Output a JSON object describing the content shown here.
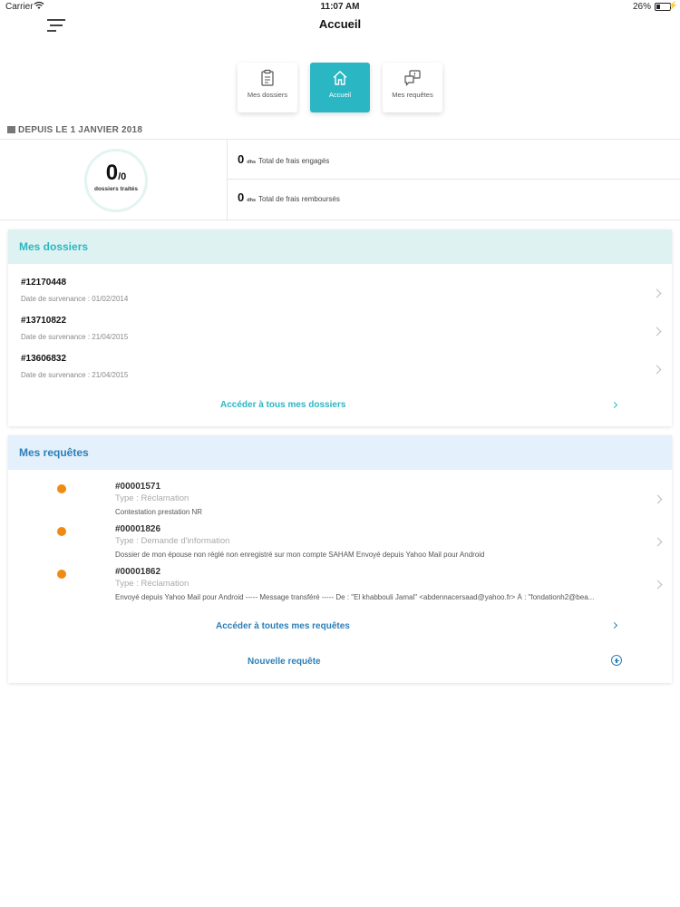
{
  "status_bar": {
    "carrier": "Carrier",
    "time": "11:07 AM",
    "battery": "26%"
  },
  "header": {
    "title": "Accueil"
  },
  "tabs": [
    {
      "label": "Mes dossiers",
      "icon": "clipboard-icon"
    },
    {
      "label": "Accueil",
      "icon": "home-icon"
    },
    {
      "label": "Mes requêtes",
      "icon": "chat-icon"
    }
  ],
  "since_label": "DEPUIS LE 1 JANVIER 2018",
  "summary": {
    "count": "0",
    "total": "/0",
    "count_label": "dossiers traités",
    "stats": [
      {
        "value": "0",
        "unit": "dhs",
        "label": "Total de frais engagés"
      },
      {
        "value": "0",
        "unit": "dhs",
        "label": "Total de frais remboursés"
      }
    ]
  },
  "dossiers": {
    "title": "Mes dossiers",
    "items": [
      {
        "number": "#12170448",
        "date": "Date de survenance : 01/02/2014"
      },
      {
        "number": "#13710822",
        "date": "Date de survenance : 21/04/2015"
      },
      {
        "number": "#13606832",
        "date": "Date de survenance : 21/04/2015"
      }
    ],
    "link": "Accéder à tous mes dossiers"
  },
  "requetes": {
    "title": "Mes requêtes",
    "items": [
      {
        "number": "#00001571",
        "type": "Type : Réclamation",
        "desc": "Contestation prestation NR"
      },
      {
        "number": "#00001826",
        "type": "Type : Demande d'information",
        "desc": "Dossier de mon épouse non réglé non enregistré sur mon compte SAHAM    Envoyé depuis Yahoo Mail pour Android"
      },
      {
        "number": "#00001862",
        "type": "Type : Réclamation",
        "desc": "Envoyé depuis Yahoo Mail pour Android    ----- Message transféré ----- De : \"El khabbouli Jamal\" <abdennacersaad@yahoo.fr> À : \"fondationh2@bea..."
      }
    ],
    "link": "Accéder à toutes mes requêtes",
    "new_link": "Nouvelle requête"
  },
  "colors": {
    "accent": "#2bb6c4",
    "blue": "#2c7fb8",
    "dot": "#ef8a12"
  }
}
